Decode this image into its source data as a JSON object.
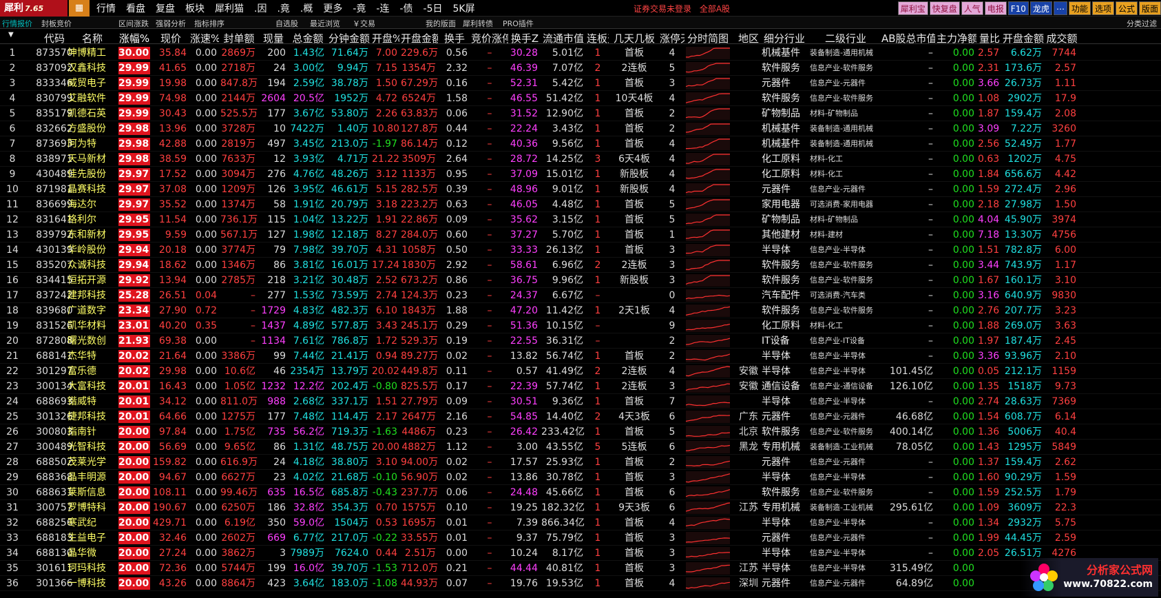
{
  "app": {
    "logo_text": "犀利",
    "version": "7.65"
  },
  "menu": [
    "行情",
    "看盘",
    "复盘",
    "板块",
    "犀利猫",
    ".因",
    ".竟",
    ".概",
    "更多",
    "-竟",
    "-连",
    "-债",
    "-5日",
    "5K屏"
  ],
  "status": {
    "login": "证券交易未登录",
    "market": "全部A股"
  },
  "right_buttons": [
    "犀利宝",
    "快复盘",
    "人气",
    "电报",
    "F10",
    "龙虎",
    "⋯",
    "功能",
    "选项",
    "公式",
    "版面"
  ],
  "toolbar": {
    "items": [
      "行情报价",
      "封板竞价",
      "区间涨跌",
      "强弱分析",
      "指标排序",
      "自选股",
      "最近浏览",
      "￥交易",
      "我的版面",
      "犀利转债",
      "PRO插件"
    ],
    "right": "分类过滤"
  },
  "columns": [
    "",
    "代码",
    "名称",
    "涨幅%",
    "现价",
    "涨速%",
    "封单额",
    "现量",
    "总金额",
    "分钟金额",
    "开盘%",
    "开盘金额",
    "换手",
    "竞价涨停买",
    "换手Z",
    "流通市值",
    "连板天",
    "几天几板",
    "涨停天",
    "分时简图",
    "地区",
    "细分行业",
    "二级行业",
    "AB股总市值",
    "主力净额",
    "量比",
    "开盘金额",
    "成交额"
  ],
  "rows": [
    [
      "1",
      "873570",
      "坤博精工",
      "30.00",
      "35.84",
      "0.00",
      "2869万",
      "200",
      "1.43亿",
      "71.64万",
      "7.00",
      "229.6万",
      "0.56",
      "–",
      "30.28",
      "5.01亿",
      "1",
      "首板",
      "4",
      "",
      "",
      "机械基件",
      "装备制造-通用机械",
      "–",
      "0.00",
      "2.57",
      "6.62万",
      "7744"
    ],
    [
      "2",
      "837092",
      "汉鑫科技",
      "29.99",
      "41.65",
      "0.00",
      "2718万",
      "24",
      "3.00亿",
      "9.94万",
      "7.15",
      "1354万",
      "2.32",
      "–",
      "46.39",
      "7.07亿",
      "2",
      "2连板",
      "5",
      "",
      "",
      "软件服务",
      "信息产业-软件服务",
      "–",
      "0.00",
      "2.31",
      "173.6万",
      "2.57"
    ],
    [
      "3",
      "833346",
      "威贸电子",
      "29.99",
      "19.98",
      "0.00",
      "847.8万",
      "194",
      "2.59亿",
      "38.78万",
      "1.50",
      "67.29万",
      "0.16",
      "–",
      "52.31",
      "5.42亿",
      "1",
      "首板",
      "3",
      "",
      "",
      "元器件",
      "信息产业-元器件",
      "–",
      "0.00",
      "3.66",
      "26.73万",
      "1.11"
    ],
    [
      "4",
      "830799",
      "艾融软件",
      "29.99",
      "74.98",
      "0.00",
      "2144万",
      "2604",
      "20.5亿",
      "1952万",
      "4.72",
      "6524万",
      "1.58",
      "–",
      "46.55",
      "51.42亿",
      "1",
      "10天4板",
      "4",
      "",
      "",
      "软件服务",
      "信息产业-软件服务",
      "–",
      "0.00",
      "1.08",
      "2902万",
      "17.9"
    ],
    [
      "5",
      "835179",
      "凯德石英",
      "29.99",
      "30.43",
      "0.00",
      "525.5万",
      "177",
      "3.67亿",
      "53.80万",
      "2.26",
      "63.83万",
      "0.06",
      "–",
      "31.52",
      "12.90亿",
      "1",
      "首板",
      "2",
      "",
      "",
      "矿物制品",
      "材料-矿物制品",
      "–",
      "0.00",
      "1.87",
      "159.4万",
      "2.08"
    ],
    [
      "6",
      "832662",
      "方盛股份",
      "29.98",
      "13.96",
      "0.00",
      "3728万",
      "10",
      "7422万",
      "1.40万",
      "10.80",
      "127.8万",
      "0.44",
      "–",
      "22.24",
      "3.43亿",
      "1",
      "首板",
      "2",
      "",
      "",
      "机械基件",
      "装备制造-通用机械",
      "–",
      "0.00",
      "3.09",
      "7.22万",
      "3260"
    ],
    [
      "7",
      "873693",
      "阿为特",
      "29.98",
      "42.88",
      "0.00",
      "2819万",
      "497",
      "3.45亿",
      "213.0万",
      "-1.97",
      "86.14万",
      "0.12",
      "–",
      "40.36",
      "9.56亿",
      "1",
      "首板",
      "4",
      "",
      "",
      "机械基件",
      "装备制造-通用机械",
      "–",
      "0.00",
      "2.56",
      "52.49万",
      "1.77"
    ],
    [
      "8",
      "838971",
      "天马新材",
      "29.98",
      "38.59",
      "0.00",
      "7633万",
      "12",
      "3.93亿",
      "4.71万",
      "21.22",
      "3509万",
      "2.64",
      "–",
      "28.72",
      "14.25亿",
      "3",
      "6天4板",
      "4",
      "",
      "",
      "化工原料",
      "材料-化工",
      "–",
      "0.00",
      "0.63",
      "1202万",
      "4.75"
    ],
    [
      "9",
      "430489",
      "佳先股份",
      "29.97",
      "17.52",
      "0.00",
      "3094万",
      "276",
      "4.76亿",
      "48.26万",
      "3.12",
      "1133万",
      "0.95",
      "–",
      "37.09",
      "15.01亿",
      "1",
      "新股板",
      "4",
      "",
      "",
      "化工原料",
      "材料-化工",
      "–",
      "0.00",
      "1.84",
      "656.6万",
      "4.42"
    ],
    [
      "10",
      "871981",
      "晶赛科技",
      "29.97",
      "37.08",
      "0.00",
      "1209万",
      "126",
      "3.95亿",
      "46.61万",
      "5.15",
      "282.5万",
      "0.39",
      "–",
      "48.96",
      "9.01亿",
      "1",
      "新股板",
      "4",
      "",
      "",
      "元器件",
      "信息产业-元器件",
      "–",
      "0.00",
      "1.59",
      "272.4万",
      "2.96"
    ],
    [
      "11",
      "836699",
      "海达尔",
      "29.97",
      "35.52",
      "0.00",
      "1374万",
      "58",
      "1.91亿",
      "20.79万",
      "3.18",
      "223.2万",
      "0.63",
      "–",
      "46.05",
      "4.48亿",
      "1",
      "首板",
      "5",
      "",
      "",
      "家用电器",
      "可选消费-家用电器",
      "–",
      "0.00",
      "2.18",
      "27.98万",
      "1.50"
    ],
    [
      "12",
      "831641",
      "格利尔",
      "29.95",
      "11.54",
      "0.00",
      "736.1万",
      "115",
      "1.04亿",
      "13.22万",
      "1.91",
      "22.86万",
      "0.09",
      "–",
      "35.62",
      "3.15亿",
      "1",
      "首板",
      "5",
      "",
      "",
      "矿物制品",
      "材料-矿物制品",
      "–",
      "0.00",
      "4.04",
      "45.90万",
      "3974"
    ],
    [
      "13",
      "839792",
      "东和新材",
      "29.95",
      "9.59",
      "0.00",
      "567.1万",
      "127",
      "1.98亿",
      "12.18万",
      "8.27",
      "284.0万",
      "0.60",
      "–",
      "37.27",
      "5.70亿",
      "1",
      "首板",
      "1",
      "",
      "",
      "其他建材",
      "材料-建材",
      "–",
      "0.00",
      "7.18",
      "13.30万",
      "4756"
    ],
    [
      "14",
      "430139",
      "华岭股份",
      "29.94",
      "20.18",
      "0.00",
      "3774万",
      "79",
      "7.98亿",
      "39.70万",
      "4.31",
      "1058万",
      "0.50",
      "–",
      "33.33",
      "26.13亿",
      "1",
      "首板",
      "3",
      "",
      "",
      "半导体",
      "信息产业-半导体",
      "–",
      "0.00",
      "1.51",
      "782.8万",
      "6.00"
    ],
    [
      "15",
      "835207",
      "众诚科技",
      "29.94",
      "18.62",
      "0.00",
      "1346万",
      "86",
      "3.81亿",
      "16.01万",
      "17.24",
      "1830万",
      "2.92",
      "–",
      "58.61",
      "6.96亿",
      "2",
      "2连板",
      "3",
      "",
      "",
      "软件服务",
      "信息产业-软件服务",
      "–",
      "0.00",
      "3.44",
      "743.9万",
      "1.17"
    ],
    [
      "16",
      "834415",
      "恒拓开源",
      "29.92",
      "13.94",
      "0.00",
      "2785万",
      "218",
      "3.21亿",
      "30.48万",
      "2.52",
      "673.2万",
      "0.86",
      "–",
      "36.75",
      "9.96亿",
      "1",
      "新股板",
      "3",
      "",
      "",
      "软件服务",
      "信息产业-软件服务",
      "–",
      "0.00",
      "1.67",
      "160.1万",
      "3.10"
    ],
    [
      "17",
      "837242",
      "建邦科技",
      "25.28",
      "26.51",
      "0.04",
      "–",
      "277",
      "1.53亿",
      "73.59万",
      "2.74",
      "124.3万",
      "0.23",
      "–",
      "24.37",
      "6.67亿",
      "–",
      "",
      "0",
      "",
      "",
      "汽车配件",
      "可选消费-汽车类",
      "–",
      "0.00",
      "3.16",
      "640.9万",
      "9830"
    ],
    [
      "18",
      "839680",
      "广道数字",
      "23.34",
      "27.90",
      "0.72",
      "–",
      "1729",
      "4.83亿",
      "482.3万",
      "6.10",
      "1843万",
      "1.88",
      "–",
      "47.20",
      "11.42亿",
      "1",
      "2天1板",
      "4",
      "",
      "",
      "软件服务",
      "信息产业-软件服务",
      "–",
      "0.00",
      "2.76",
      "207.7万",
      "3.23"
    ],
    [
      "19",
      "831526",
      "凯华材料",
      "23.01",
      "40.20",
      "0.35",
      "–",
      "1437",
      "4.89亿",
      "577.8万",
      "3.43",
      "245.1万",
      "0.29",
      "–",
      "51.36",
      "10.15亿",
      "–",
      "",
      "9",
      "",
      "",
      "化工原料",
      "材料-化工",
      "–",
      "0.00",
      "1.88",
      "269.0万",
      "3.63"
    ],
    [
      "20",
      "872808",
      "曙光数创",
      "21.93",
      "69.38",
      "0.00",
      "–",
      "1134",
      "7.61亿",
      "786.8万",
      "1.72",
      "529.3万",
      "0.19",
      "–",
      "22.55",
      "36.31亿",
      "–",
      "",
      "2",
      "",
      "",
      "IT设备",
      "信息产业-IT设备",
      "–",
      "0.00",
      "1.97",
      "187.4万",
      "2.45"
    ],
    [
      "21",
      "688141",
      "杰华特",
      "20.02",
      "21.64",
      "0.00",
      "3386万",
      "99",
      "7.44亿",
      "21.41万",
      "0.94",
      "89.27万",
      "0.02",
      "–",
      "13.82",
      "56.74亿",
      "1",
      "首板",
      "2",
      "",
      "",
      "半导体",
      "信息产业-半导体",
      "–",
      "0.00",
      "3.36",
      "93.96万",
      "2.10"
    ],
    [
      "22",
      "301297",
      "富乐德",
      "20.02",
      "29.98",
      "0.00",
      "10.6亿",
      "46",
      "2354万",
      "13.79万",
      "20.02",
      "449.8万",
      "0.11",
      "–",
      "0.57",
      "41.49亿",
      "2",
      "2连板",
      "4",
      "",
      "安徽",
      "半导体",
      "信息产业-半导体",
      "101.45亿",
      "0.00",
      "0.05",
      "212.1万",
      "1159"
    ],
    [
      "23",
      "300134",
      "大富科技",
      "20.01",
      "16.43",
      "0.00",
      "1.05亿",
      "1232",
      "12.2亿",
      "202.4万",
      "-0.80",
      "825.5万",
      "0.17",
      "–",
      "22.39",
      "57.74亿",
      "1",
      "2连板",
      "3",
      "",
      "安徽",
      "通信设备",
      "信息产业-通信设备",
      "126.10亿",
      "0.00",
      "1.35",
      "1518万",
      "9.73"
    ],
    [
      "24",
      "688693",
      "锴威特",
      "20.01",
      "34.12",
      "0.00",
      "811.0万",
      "988",
      "2.68亿",
      "337.1万",
      "1.51",
      "27.79万",
      "0.09",
      "–",
      "30.51",
      "9.36亿",
      "1",
      "首板",
      "7",
      "",
      "",
      "半导体",
      "信息产业-半导体",
      "–",
      "0.00",
      "2.74",
      "28.63万",
      "7369"
    ],
    [
      "25",
      "301326",
      "捷邦科技",
      "20.01",
      "64.66",
      "0.00",
      "1275万",
      "177",
      "7.48亿",
      "114.4万",
      "2.17",
      "2647万",
      "2.16",
      "–",
      "54.85",
      "14.40亿",
      "2",
      "4天3板",
      "6",
      "",
      "广东",
      "元器件",
      "信息产业-元器件",
      "46.68亿",
      "0.00",
      "1.54",
      "608.7万",
      "6.14"
    ],
    [
      "26",
      "300803",
      "指南针",
      "20.00",
      "97.84",
      "0.00",
      "1.75亿",
      "735",
      "56.2亿",
      "719.3万",
      "-1.63",
      "4486万",
      "0.23",
      "–",
      "26.42",
      "233.42亿",
      "1",
      "首板",
      "5",
      "",
      "北京",
      "软件服务",
      "信息产业-软件服务",
      "400.14亿",
      "0.00",
      "1.36",
      "5006万",
      "40.4"
    ],
    [
      "27",
      "300489",
      "光智科技",
      "20.00",
      "56.69",
      "0.00",
      "9.65亿",
      "86",
      "1.31亿",
      "48.75万",
      "20.00",
      "4882万",
      "1.12",
      "–",
      "3.00",
      "43.55亿",
      "5",
      "5连板",
      "6",
      "",
      "黑龙",
      "专用机械",
      "装备制造-工业机械",
      "78.05亿",
      "0.00",
      "1.43",
      "1295万",
      "5849"
    ],
    [
      "28",
      "688502",
      "茂莱光学",
      "20.00",
      "159.82",
      "0.00",
      "616.9万",
      "24",
      "4.18亿",
      "38.80万",
      "3.10",
      "94.00万",
      "0.02",
      "–",
      "17.57",
      "25.93亿",
      "1",
      "首板",
      "2",
      "",
      "",
      "元器件",
      "信息产业-元器件",
      "–",
      "0.00",
      "1.37",
      "159.4万",
      "2.62"
    ],
    [
      "29",
      "688368",
      "晶丰明源",
      "20.00",
      "94.67",
      "0.00",
      "6627万",
      "23",
      "4.02亿",
      "21.68万",
      "-0.10",
      "56.90万",
      "0.02",
      "–",
      "13.86",
      "30.78亿",
      "1",
      "首板",
      "3",
      "",
      "",
      "半导体",
      "信息产业-半导体",
      "–",
      "0.00",
      "1.60",
      "90.29万",
      "1.59"
    ],
    [
      "30",
      "688631",
      "莱斯信息",
      "20.00",
      "108.11",
      "0.00",
      "99.46万",
      "635",
      "16.5亿",
      "685.8万",
      "-0.43",
      "237.7万",
      "0.06",
      "–",
      "24.48",
      "45.66亿",
      "1",
      "首板",
      "6",
      "",
      "",
      "软件服务",
      "信息产业-软件服务",
      "–",
      "0.00",
      "1.59",
      "252.5万",
      "1.79"
    ],
    [
      "31",
      "300757",
      "罗博特科",
      "20.00",
      "190.67",
      "0.00",
      "6250万",
      "186",
      "32.8亿",
      "354.3万",
      "0.70",
      "1575万",
      "0.10",
      "–",
      "19.25",
      "182.32亿",
      "1",
      "9天3板",
      "6",
      "",
      "江苏",
      "专用机械",
      "装备制造-工业机械",
      "295.61亿",
      "0.00",
      "1.09",
      "3609万",
      "22.3"
    ],
    [
      "32",
      "688256",
      "寒武纪",
      "20.00",
      "429.71",
      "0.00",
      "6.19亿",
      "350",
      "59.0亿",
      "1504万",
      "0.53",
      "1695万",
      "0.01",
      "–",
      "7.39",
      "866.34亿",
      "1",
      "首板",
      "4",
      "",
      "",
      "半导体",
      "信息产业-半导体",
      "–",
      "0.00",
      "1.34",
      "2932万",
      "5.75"
    ],
    [
      "33",
      "688183",
      "生益电子",
      "20.00",
      "32.46",
      "0.00",
      "2602万",
      "669",
      "6.77亿",
      "217.0万",
      "-0.22",
      "33.55万",
      "0.01",
      "–",
      "9.37",
      "75.79亿",
      "1",
      "首板",
      "3",
      "",
      "",
      "元器件",
      "信息产业-元器件",
      "–",
      "0.00",
      "1.99",
      "44.45万",
      "2.59"
    ],
    [
      "34",
      "688130",
      "晶华微",
      "20.00",
      "27.24",
      "0.00",
      "3862万",
      "3",
      "7989万",
      "7624.0",
      "0.44",
      "2.51万",
      "0.00",
      "–",
      "10.24",
      "8.17亿",
      "1",
      "首板",
      "3",
      "",
      "",
      "半导体",
      "信息产业-半导体",
      "–",
      "0.00",
      "2.05",
      "26.51万",
      "4276"
    ],
    [
      "35",
      "301611",
      "珂玛科技",
      "20.00",
      "72.36",
      "0.00",
      "5744万",
      "199",
      "16.0亿",
      "39.70万",
      "-1.53",
      "712.0万",
      "0.21",
      "–",
      "44.44",
      "40.81亿",
      "1",
      "首板",
      "3",
      "",
      "江苏",
      "半导体",
      "信息产业-半导体",
      "315.49亿",
      "0.00",
      "",
      "",
      ""
    ],
    [
      "36",
      "301366",
      "一博科技",
      "20.00",
      "43.26",
      "0.00",
      "8864万",
      "423",
      "3.64亿",
      "183.0万",
      "-1.08",
      "44.93万",
      "0.07",
      "–",
      "19.76",
      "19.53亿",
      "1",
      "首板",
      "4",
      "",
      "深圳",
      "元器件",
      "信息产业-元器件",
      "64.89亿",
      "0.00",
      "",
      "",
      ""
    ]
  ],
  "watermark": {
    "name": "分析家公式网",
    "url": "www.70822.com"
  }
}
